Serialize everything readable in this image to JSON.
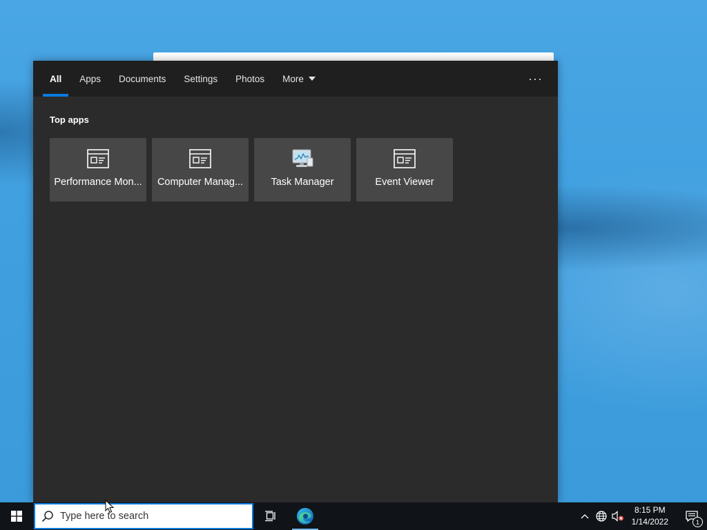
{
  "search_panel": {
    "tabs": [
      {
        "label": "All",
        "active": true
      },
      {
        "label": "Apps",
        "active": false
      },
      {
        "label": "Documents",
        "active": false
      },
      {
        "label": "Settings",
        "active": false
      },
      {
        "label": "Photos",
        "active": false
      },
      {
        "label": "More",
        "active": false,
        "dropdown": true
      }
    ],
    "options_icon": "ellipsis-icon",
    "section_title": "Top apps",
    "top_apps": [
      {
        "label": "Performance Mon...",
        "icon": "admin-tool-icon"
      },
      {
        "label": "Computer Manag...",
        "icon": "admin-tool-icon"
      },
      {
        "label": "Task Manager",
        "icon": "task-manager-icon"
      },
      {
        "label": "Event Viewer",
        "icon": "admin-tool-icon"
      }
    ]
  },
  "taskbar": {
    "start_icon": "windows-logo-icon",
    "search": {
      "placeholder": "Type here to search",
      "value": "",
      "icon": "search-icon"
    },
    "task_view_icon": "task-view-icon",
    "pinned": [
      {
        "icon": "edge-icon",
        "running": true
      }
    ],
    "tray": {
      "icons": [
        "chevron-up-icon",
        "network-globe-icon",
        "volume-muted-icon"
      ],
      "time": "8:15 PM",
      "date": "1/14/2022",
      "notifications_count": "1"
    }
  },
  "colors": {
    "accent": "#0a7ae0",
    "panel": "#2b2b2b",
    "tile": "#474747",
    "taskbar": "#101418"
  }
}
